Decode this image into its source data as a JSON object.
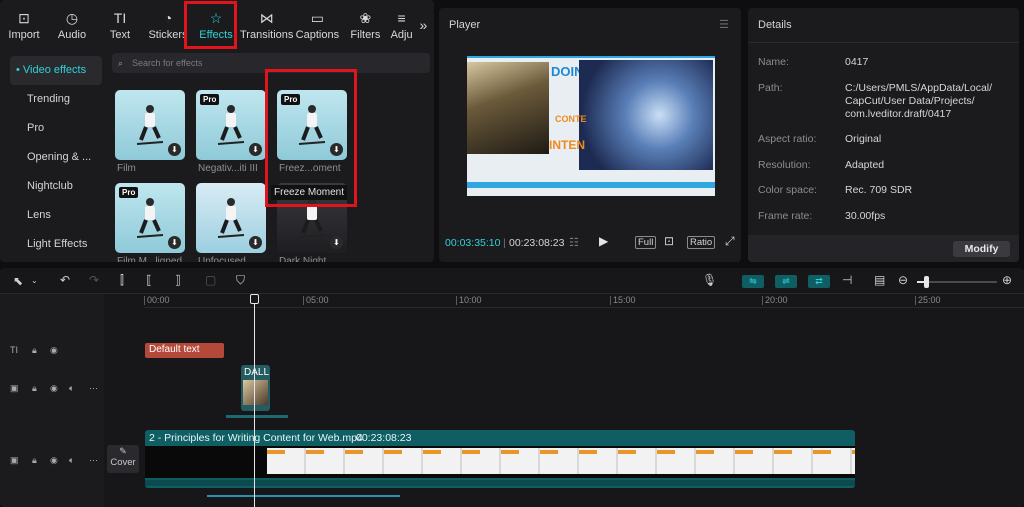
{
  "toolbar": {
    "tabs": [
      {
        "label": "Import",
        "icon": "import-icon",
        "glyph": "⊡"
      },
      {
        "label": "Audio",
        "icon": "audio-icon",
        "glyph": "◷"
      },
      {
        "label": "Text",
        "icon": "text-icon",
        "glyph": "TI"
      },
      {
        "label": "Stickers",
        "icon": "stickers-icon",
        "glyph": "◔"
      },
      {
        "label": "Effects",
        "icon": "effects-icon",
        "glyph": "☆",
        "active": true
      },
      {
        "label": "Transitions",
        "icon": "transitions-icon",
        "glyph": "⋈"
      },
      {
        "label": "Captions",
        "icon": "captions-icon",
        "glyph": "▭"
      },
      {
        "label": "Filters",
        "icon": "filters-icon",
        "glyph": "❀"
      },
      {
        "label": "Adju",
        "icon": "adjust-icon",
        "glyph": "≡"
      }
    ],
    "more": "»"
  },
  "sidebar": {
    "items": [
      "• Video effects",
      "Trending",
      "Pro",
      "Opening & ...",
      "Nightclub",
      "Lens",
      "Light Effects"
    ]
  },
  "search": {
    "placeholder": "Search for effects"
  },
  "effects": {
    "items": [
      {
        "name": "Film",
        "pro": false
      },
      {
        "name": "Negativ...iti III",
        "pro": true
      },
      {
        "name": "Freez...oment",
        "pro": true
      },
      {
        "name": "Film M...ligned",
        "pro": true
      },
      {
        "name": "Unfocused",
        "pro": false
      },
      {
        "name": "Dark Night",
        "pro": false
      }
    ],
    "badge": "Pro",
    "tooltip": "Freeze Moment"
  },
  "player": {
    "title": "Player",
    "current": "00:03:35:10",
    "total": "00:23:08:23",
    "full": "Full",
    "ratio": "Ratio",
    "preview": {
      "doing": "DOING",
      "cont": "CONTE",
      "inten": "INTEN"
    }
  },
  "details": {
    "title": "Details",
    "rows": [
      {
        "label": "Name:",
        "value": "0417"
      },
      {
        "label": "Path:",
        "value": "C:/Users/PMLS/AppData/Local/\nCapCut/User Data/Projects/\ncom.lveditor.draft/0417"
      },
      {
        "label": "Aspect ratio:",
        "value": "Original"
      },
      {
        "label": "Resolution:",
        "value": "Adapted"
      },
      {
        "label": "Color space:",
        "value": "Rec. 709 SDR"
      },
      {
        "label": "Frame rate:",
        "value": "30.00fps"
      }
    ],
    "modify": "Modify"
  },
  "timeline": {
    "ruler": [
      "00:00",
      "05:00",
      "10:00",
      "15:00",
      "20:00",
      "25:00"
    ],
    "text_clip": "Default text",
    "sticker_clip": "DALL·",
    "cover": "Cover",
    "main_clip": {
      "name": "2 -  Principles for Writing Content for Web.mp4",
      "duration": "00:23:08:23"
    }
  },
  "colors": {
    "accent": "#2fd3d8",
    "text_clip": "#b4493a",
    "main_clip": "#0f5e63",
    "highlight": "#e0141c"
  }
}
